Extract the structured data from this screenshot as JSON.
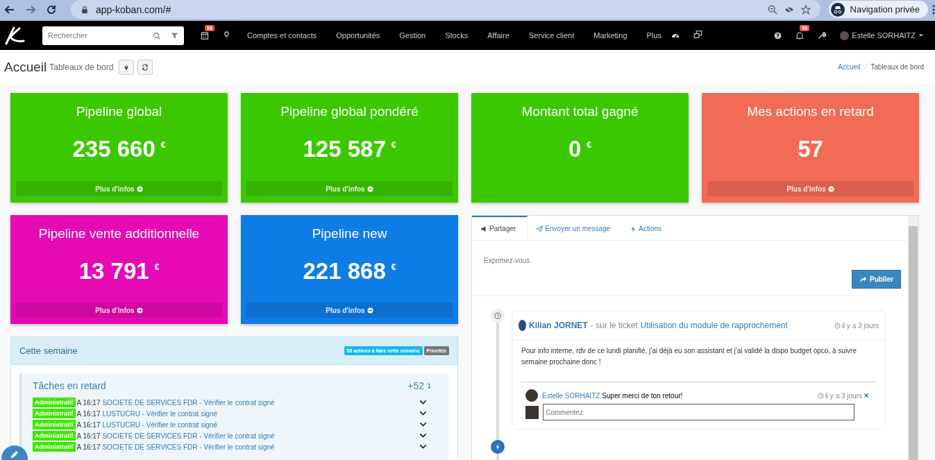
{
  "browser": {
    "url": "app-koban.com/#",
    "profile_label": "Navigation privée"
  },
  "topbar": {
    "search_placeholder": "Rechercher",
    "calendar_badge": "58",
    "menu": [
      "Comptes et contacts",
      "Opportunités",
      "Gestion",
      "Stocks",
      "Affaire",
      "Service client",
      "Marketing",
      "Plus"
    ],
    "notification_badge": "58",
    "user": "Estelle SORHAITZ"
  },
  "header": {
    "title": "Accueil",
    "subtitle": "Tableaux de bord",
    "breadcrumb": [
      "Accueil",
      "Tableaux de bord"
    ],
    "breadcrumb_separator": "/"
  },
  "cards": [
    {
      "title": "Pipeline global",
      "value": "235 660",
      "currency": "€",
      "link": "Plus d'infos",
      "color": "#3cc800"
    },
    {
      "title": "Pipeline global pondéré",
      "value": "125 587",
      "currency": "€",
      "link": "Plus d'infos",
      "color": "#3cc800"
    },
    {
      "title": "Montant total gagné",
      "value": "0",
      "currency": "€",
      "color": "#3cc800"
    },
    {
      "title": "Mes actions en retard",
      "value": "57",
      "link": "Plus d'infos",
      "color": "#f26b55"
    },
    {
      "title": "Pipeline vente additionnelle",
      "value": "13 791",
      "currency": "€",
      "link": "Plus d'infos",
      "color": "#e60ab4"
    },
    {
      "title": "Pipeline new",
      "value": "221 868",
      "currency": "€",
      "link": "Plus d'infos",
      "color": "#0f7de6"
    }
  ],
  "week": {
    "title": "Cette semaine",
    "badges": [
      {
        "text": "58 actions à faire cette semaine",
        "color": "#19b9e6"
      },
      {
        "text": "Priorités",
        "color": "#777777"
      }
    ],
    "tasks": {
      "title": "Tâches en retard",
      "count": "+52",
      "items": [
        {
          "tag": "Administratif",
          "time": "A 16:17",
          "link": "SOCIETE DE SERVICES FDR - Vérifier le contrat signé"
        },
        {
          "tag": "Administratif",
          "time": "A 16:17",
          "link": "LUSTUCRU - Vérifier le contrat signé"
        },
        {
          "tag": "Administratif",
          "time": "A 16:17",
          "link": "LUSTUCRU - Vérifier le contrat signé"
        },
        {
          "tag": "Administratif",
          "time": "A 16:17",
          "link": "SOCIETE DE SERVICES FDR - Vérifier le contrat signé"
        },
        {
          "tag": "Administratif",
          "time": "A 16:17",
          "link": "SOCIETE DE SERVICES FDR - Vérifier le contrat signé"
        }
      ]
    }
  },
  "feed": {
    "tabs": [
      {
        "label": "Partager",
        "selected": true
      },
      {
        "label": "Envoyer un message",
        "selected": false
      },
      {
        "label": "Actions",
        "selected": false
      }
    ],
    "placeholder": "Exprimez-vous",
    "publish": "Publier",
    "post": {
      "author": "Kilian JORNET",
      "context": "- sur le ticket",
      "subject": "Utilisation du module de rapprochement",
      "time": "il y a 3 jours",
      "body": "Pour info interne, rdv de ce lundi planifié, j'ai déjà eu son assistant et j'ai validé la dispo budget opco, à suivre semaine prochaine donc !",
      "comment": {
        "author": "Estelle SORHAITZ",
        "text": "Super merci de ton retour!",
        "time": "il y a 3 jours"
      },
      "comment_placeholder": "Commentez"
    }
  }
}
